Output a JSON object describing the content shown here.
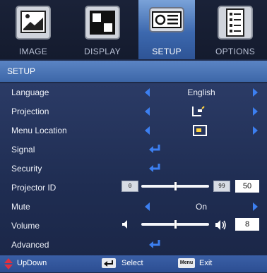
{
  "tabs": [
    {
      "label": "IMAGE",
      "icon": "image-icon"
    },
    {
      "label": "DISPLAY",
      "icon": "display-icon"
    },
    {
      "label": "SETUP",
      "icon": "projector-icon",
      "active": true
    },
    {
      "label": "OPTIONS",
      "icon": "options-checklist-icon"
    }
  ],
  "header": {
    "title": "SETUP"
  },
  "menu": {
    "language": {
      "label": "Language",
      "value": "English"
    },
    "projection": {
      "label": "Projection",
      "icon": "projection-mode-icon"
    },
    "menu_location": {
      "label": "Menu Location",
      "icon": "menu-location-icon"
    },
    "signal": {
      "label": "Signal",
      "icon": "enter-icon"
    },
    "security": {
      "label": "Security",
      "icon": "enter-icon"
    },
    "projector_id": {
      "label": "Projector ID",
      "min": "0",
      "max": "99",
      "value": "50",
      "level": 0.5
    },
    "mute": {
      "label": "Mute",
      "value": "On"
    },
    "volume": {
      "label": "Volume",
      "value": "8",
      "level": 0.5
    },
    "advanced": {
      "label": "Advanced",
      "icon": "enter-icon"
    }
  },
  "footer": {
    "updown": {
      "label": "UpDown",
      "icon": "updown-arrows-icon"
    },
    "select": {
      "label": "Select",
      "icon": "enter-key-icon"
    },
    "exit": {
      "label": "Exit",
      "key": "Menu"
    }
  },
  "colors": {
    "accent_arrow": "#3c7ff0",
    "active_tab": "#4f7cc0",
    "header": "#4c76b8"
  }
}
